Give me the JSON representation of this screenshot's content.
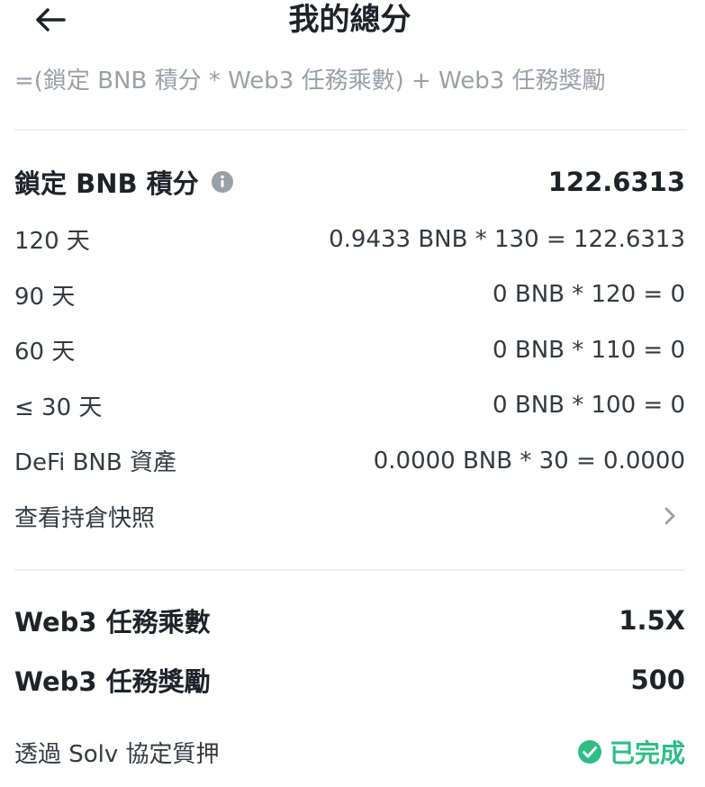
{
  "header": {
    "back_icon": "arrow-left-icon",
    "title": "我的總分"
  },
  "formula": "=(鎖定 BNB 積分 * Web3 任務乘數) + Web3 任務獎勵",
  "locked": {
    "label": "鎖定 BNB 積分",
    "info_icon": "info-icon",
    "total": "122.6313",
    "rows": [
      {
        "label": "120 天",
        "value": "0.9433 BNB * 130 = 122.6313"
      },
      {
        "label": "90 天",
        "value": "0 BNB * 120 = 0"
      },
      {
        "label": "60 天",
        "value": "0 BNB * 110 = 0"
      },
      {
        "label": "≤ 30 天",
        "value": "0 BNB * 100 = 0"
      },
      {
        "label": "DeFi BNB 資產",
        "value": "0.0000 BNB * 30 = 0.0000"
      }
    ],
    "snapshot_label": "查看持倉快照",
    "snapshot_icon": "chevron-right-icon"
  },
  "web3": {
    "multiplier_label": "Web3 任務乘數",
    "multiplier_value": "1.5X",
    "reward_label": "Web3 任務獎勵",
    "reward_value": "500",
    "task_label": "透過 Solv 協定質押",
    "task_status": "已完成",
    "task_status_icon": "check-circle-icon"
  },
  "colors": {
    "text": "#1e2329",
    "muted": "#9aa0a8",
    "success": "#2ebd85",
    "divider": "#eef0f2"
  }
}
